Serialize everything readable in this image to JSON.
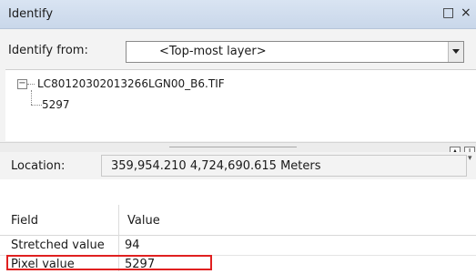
{
  "window": {
    "title": "Identify",
    "controls": {
      "restore": "□",
      "close": "×"
    }
  },
  "identify_from": {
    "label": "Identify from:",
    "selected": "<Top-most layer>"
  },
  "tree": {
    "expander": "−",
    "root_label": "LC80120302013266LGN00_B6.TIF",
    "child_label": "5297"
  },
  "location": {
    "label": "Location:",
    "value": "359,954.210  4,724,690.615 Meters"
  },
  "grid": {
    "columns": [
      "Field",
      "Value"
    ],
    "rows": [
      {
        "field": "Stretched value",
        "value": "94"
      },
      {
        "field": "Pixel value",
        "value": "5297"
      }
    ]
  },
  "colors": {
    "highlight": "#e02020",
    "titlebar": "#cfdbec"
  },
  "icons": [
    "restore-icon",
    "close-icon",
    "dropdown-arrow-icon",
    "collapse-icon",
    "pin-icon"
  ]
}
